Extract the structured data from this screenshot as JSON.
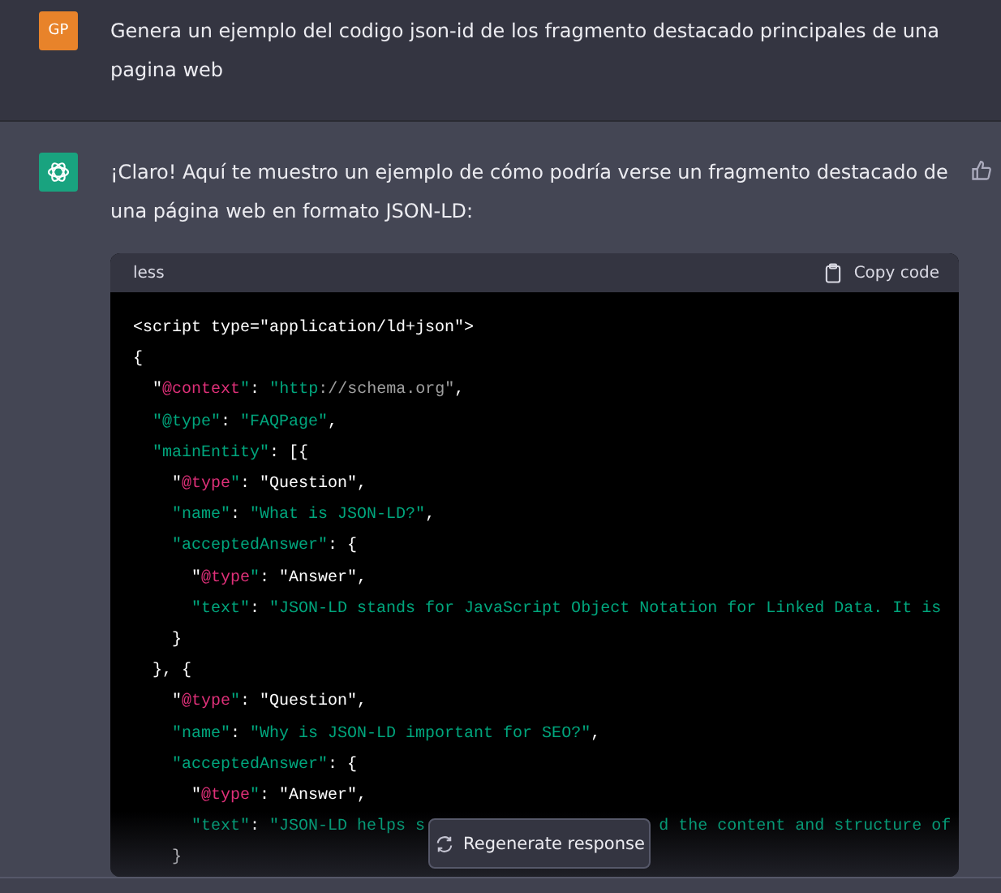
{
  "user_message": {
    "avatar": "GP",
    "text": "Genera un ejemplo del codigo json-id de los fragmento destacado principales de una pagina web"
  },
  "assistant_message": {
    "text": "¡Claro! Aquí te muestro un ejemplo de cómo podría verse un fragmento destacado de una página web en formato JSON-LD:",
    "code_block": {
      "language": "less",
      "copy_label": "Copy code",
      "lines": [
        [
          {
            "kind": "plain",
            "text": "<script type=\"application/ld+json\">"
          }
        ],
        [
          {
            "kind": "plain",
            "text": "{"
          }
        ],
        [
          {
            "kind": "plain",
            "text": "  \""
          },
          {
            "kind": "at",
            "text": "@context"
          },
          {
            "kind": "str",
            "text": "\""
          },
          {
            "kind": "plain",
            "text": ": "
          },
          {
            "kind": "str",
            "text": "\"http"
          },
          {
            "kind": "comment",
            "text": "://schema.org\""
          },
          {
            "kind": "plain",
            "text": ","
          }
        ],
        [
          {
            "kind": "str",
            "text": "  \"@type\""
          },
          {
            "kind": "plain",
            "text": ": "
          },
          {
            "kind": "str",
            "text": "\"FAQPage\""
          },
          {
            "kind": "plain",
            "text": ","
          }
        ],
        [
          {
            "kind": "str",
            "text": "  \"mainEntity\""
          },
          {
            "kind": "plain",
            "text": ": [{"
          }
        ],
        [
          {
            "kind": "plain",
            "text": "    \""
          },
          {
            "kind": "at",
            "text": "@type"
          },
          {
            "kind": "str",
            "text": "\""
          },
          {
            "kind": "plain",
            "text": ": \"Question\","
          }
        ],
        [
          {
            "kind": "str",
            "text": "    \"name\""
          },
          {
            "kind": "plain",
            "text": ": "
          },
          {
            "kind": "str",
            "text": "\"What is JSON-LD?\""
          },
          {
            "kind": "plain",
            "text": ","
          }
        ],
        [
          {
            "kind": "str",
            "text": "    \"acceptedAnswer\""
          },
          {
            "kind": "plain",
            "text": ": {"
          }
        ],
        [
          {
            "kind": "plain",
            "text": "      \""
          },
          {
            "kind": "at",
            "text": "@type"
          },
          {
            "kind": "str",
            "text": "\""
          },
          {
            "kind": "plain",
            "text": ": \"Answer\","
          }
        ],
        [
          {
            "kind": "str",
            "text": "      \"text\""
          },
          {
            "kind": "plain",
            "text": ": "
          },
          {
            "kind": "str",
            "text": "\"JSON-LD stands for JavaScript Object Notation for Linked Data. It is"
          }
        ],
        [
          {
            "kind": "plain",
            "text": "    }"
          }
        ],
        [
          {
            "kind": "plain",
            "text": "  }, {"
          }
        ],
        [
          {
            "kind": "plain",
            "text": "    \""
          },
          {
            "kind": "at",
            "text": "@type"
          },
          {
            "kind": "str",
            "text": "\""
          },
          {
            "kind": "plain",
            "text": ": \"Question\","
          }
        ],
        [
          {
            "kind": "str",
            "text": "    \"name\""
          },
          {
            "kind": "plain",
            "text": ": "
          },
          {
            "kind": "str",
            "text": "\"Why is JSON-LD important for SEO?\""
          },
          {
            "kind": "plain",
            "text": ","
          }
        ],
        [
          {
            "kind": "str",
            "text": "    \"acceptedAnswer\""
          },
          {
            "kind": "plain",
            "text": ": {"
          }
        ],
        [
          {
            "kind": "plain",
            "text": "      \""
          },
          {
            "kind": "at",
            "text": "@type"
          },
          {
            "kind": "str",
            "text": "\""
          },
          {
            "kind": "plain",
            "text": ": \"Answer\","
          }
        ],
        [
          {
            "kind": "str",
            "text": "      \"text\""
          },
          {
            "kind": "plain",
            "text": ": "
          },
          {
            "kind": "str",
            "text": "\"JSON-LD helps s"
          },
          {
            "kind": "gap"
          },
          {
            "kind": "str",
            "text": "d the content and structure of"
          }
        ],
        [
          {
            "kind": "plain",
            "text": "    }"
          }
        ]
      ]
    }
  },
  "regenerate_button": {
    "label": "Regenerate response"
  }
}
